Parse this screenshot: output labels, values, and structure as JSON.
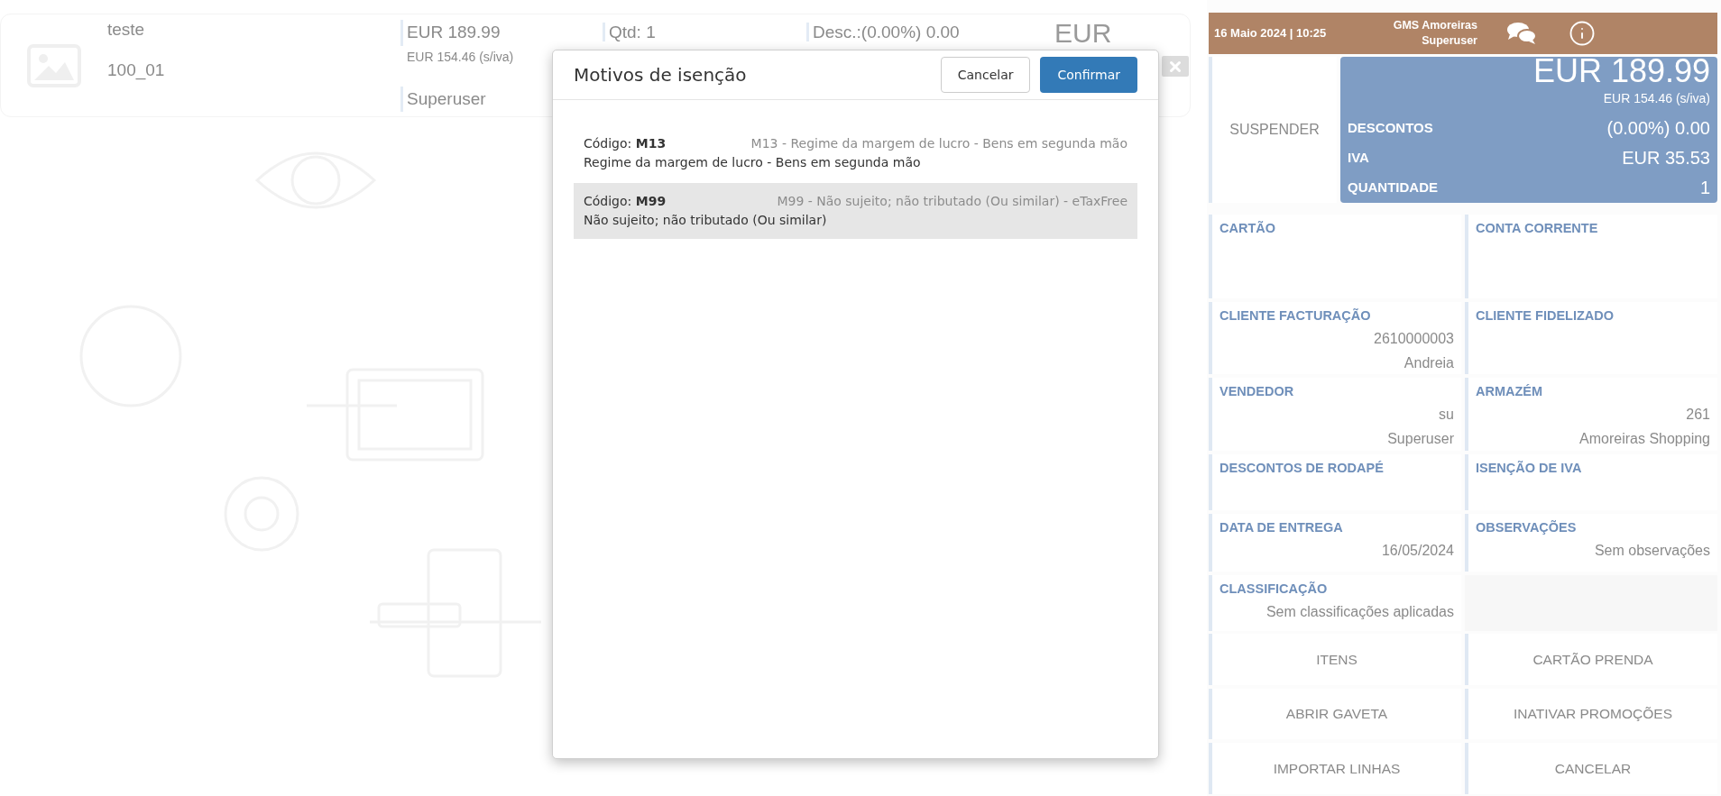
{
  "product": {
    "name": "teste",
    "code": "100_01",
    "price": "EUR 189.99",
    "price_net": "EUR 154.46 (s/iva)",
    "user": "Superuser",
    "quantity": "Qtd: 1",
    "discount": "Desc.:(0.00%) 0.00",
    "total": "EUR"
  },
  "header": {
    "datetime": "16 Maio 2024 | 10:25",
    "store": "GMS Amoreiras",
    "user": "Superuser"
  },
  "suspend_button": "SUSPENDER",
  "summary": {
    "total": "EUR 189.99",
    "total_net": "EUR 154.46 (s/iva)",
    "rows": [
      {
        "label": "DESCONTOS",
        "value": "(0.00%) 0.00"
      },
      {
        "label": "IVA",
        "value": "EUR 35.53"
      },
      {
        "label": "QUANTIDADE",
        "value": "1"
      }
    ]
  },
  "tiles": [
    {
      "label": "CARTÃO"
    },
    {
      "label": "CONTA CORRENTE"
    },
    {
      "label": "CLIENTE FACTURAÇÃO",
      "values": [
        "2610000003",
        "Andreia"
      ]
    },
    {
      "label": "CLIENTE FIDELIZADO"
    },
    {
      "label": "VENDEDOR",
      "values": [
        "su",
        "Superuser"
      ]
    },
    {
      "label": "ARMAZÉM",
      "values": [
        "261",
        "Amoreiras Shopping"
      ]
    },
    {
      "label": "DESCONTOS DE RODAPÉ"
    },
    {
      "label": "ISENÇÃO DE IVA"
    },
    {
      "label": "DATA DE ENTREGA",
      "values": [
        "16/05/2024"
      ]
    },
    {
      "label": "OBSERVAÇÕES",
      "values": [
        "Sem observações"
      ]
    },
    {
      "label": "CLASSIFICAÇÃO",
      "values": [
        "Sem classificações aplicadas"
      ]
    }
  ],
  "actions": [
    "ITENS",
    "CARTÃO PRENDA",
    "ABRIR GAVETA",
    "INATIVAR PROMOÇÕES",
    "IMPORTAR LINHAS",
    "CANCELAR"
  ],
  "dialog": {
    "title": "Motivos de isenção",
    "buttons": [
      {
        "label": "Cancelar",
        "kind": "secondary"
      },
      {
        "label": "Confirmar",
        "kind": "primary"
      }
    ],
    "items": [
      {
        "code_line": "Código: **M13**",
        "title": "M13 - Regime da margem de lucro - Bens em segunda mão",
        "description": "Regime da margem de lucro - Bens em segunda mão",
        "selected": false
      },
      {
        "code_line": "Código: **M99**",
        "title": "M99 - Não sujeito; não tributado (Ou similar) - eTaxFree",
        "description": "Não sujeito; não tributado (Ou similar)",
        "selected": true
      }
    ]
  }
}
